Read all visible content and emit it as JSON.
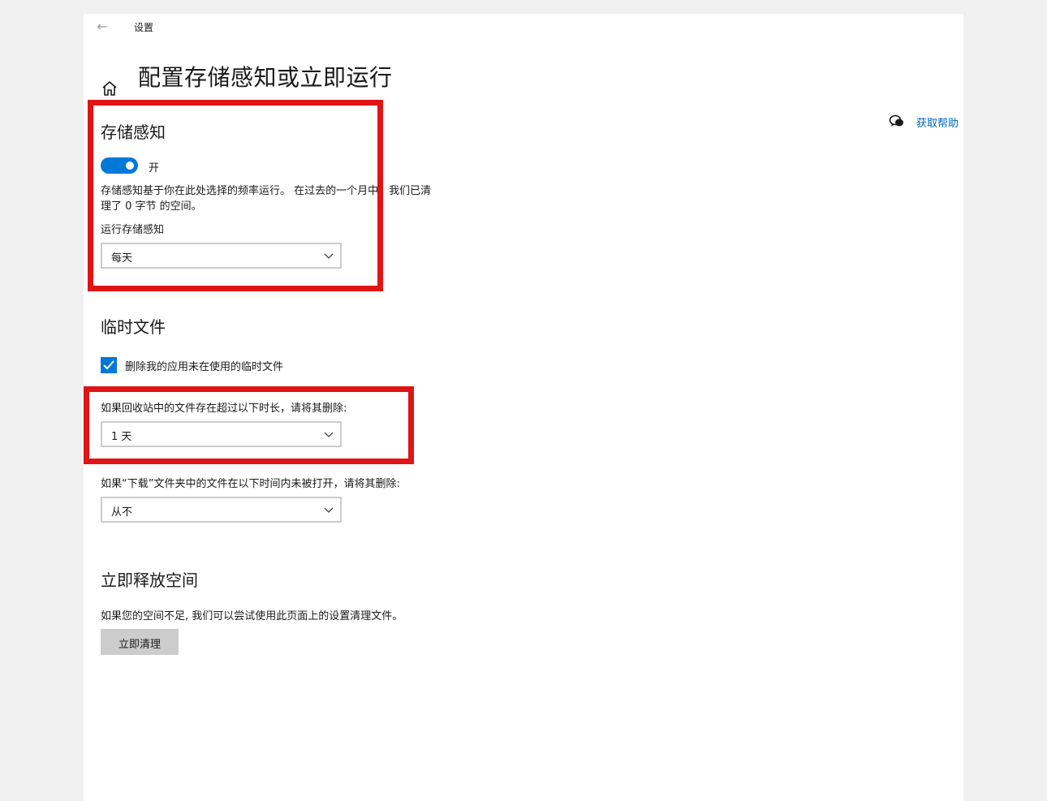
{
  "titlebar": {
    "back_icon": "back-arrow-icon",
    "title": "设置"
  },
  "page": {
    "title": "配置存储感知或立即运行",
    "home_icon": "home-icon"
  },
  "help": {
    "icon": "help-chat-icon",
    "link": "获取帮助"
  },
  "storage_sense": {
    "heading": "存储感知",
    "toggle_state": "on",
    "toggle_label": "开",
    "description_line1": "存储感知基于你在此处选择的频率运行。 在过去的一个月中，我们已清",
    "description_line2": "理了 0 字节 的空间。",
    "run_label": "运行存储感知",
    "run_value": "每天"
  },
  "temp_files": {
    "heading": "临时文件",
    "checkbox_checked": true,
    "checkbox_label": "删除我的应用未在使用的临时文件",
    "recycle_label": "如果回收站中的文件存在超过以下时长，请将其删除:",
    "recycle_value": "1 天",
    "downloads_label": "如果“下载”文件夹中的文件在以下时间内未被打开，请将其删除:",
    "downloads_value": "从不"
  },
  "free_space": {
    "heading": "立即释放空间",
    "description": "如果您的空间不足, 我们可以尝试使用此页面上的设置清理文件。",
    "button": "立即清理"
  },
  "colors": {
    "accent": "#0078d7",
    "highlight": "#e01414",
    "link": "#0067c0"
  }
}
